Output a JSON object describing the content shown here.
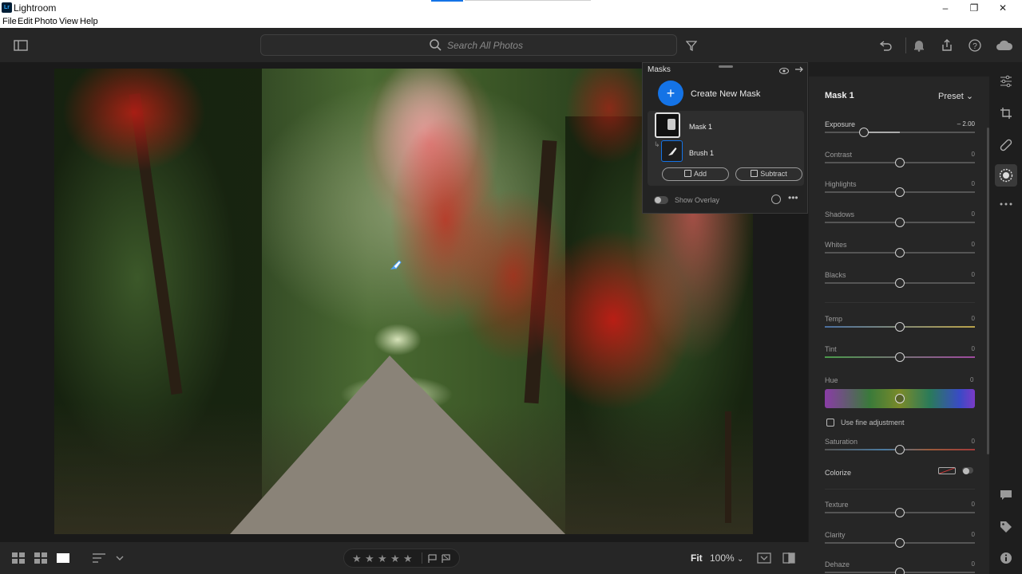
{
  "window": {
    "title": "Lightroom",
    "logo_text": "Lr"
  },
  "menu": [
    "File",
    "Edit",
    "Photo",
    "View",
    "Help"
  ],
  "window_controls": {
    "minimize": "–",
    "maximize": "❐",
    "close": "✕"
  },
  "search": {
    "placeholder": "Search All Photos"
  },
  "masks_panel": {
    "header": "Masks",
    "create_label": "Create New Mask",
    "masks": [
      {
        "name": "Mask 1",
        "components": [
          {
            "name": "Brush 1"
          }
        ]
      }
    ],
    "add_label": "Add",
    "subtract_label": "Subtract",
    "show_overlay_label": "Show Overlay"
  },
  "edit_panel": {
    "mask_name": "Mask 1",
    "preset_label": "Preset",
    "sliders": [
      {
        "label": "Exposure",
        "value": "– 2.00",
        "position": 0.26
      },
      {
        "label": "Contrast",
        "value": "0",
        "position": 0.5
      },
      {
        "label": "Highlights",
        "value": "0",
        "position": 0.5
      },
      {
        "label": "Shadows",
        "value": "0",
        "position": 0.5
      },
      {
        "label": "Whites",
        "value": "0",
        "position": 0.5
      },
      {
        "label": "Blacks",
        "value": "0",
        "position": 0.5
      },
      {
        "label": "Temp",
        "value": "0",
        "position": 0.5
      },
      {
        "label": "Tint",
        "value": "0",
        "position": 0.5
      }
    ],
    "hue": {
      "label": "Hue",
      "value": "0"
    },
    "fine_adjust_label": "Use fine adjustment",
    "saturation": {
      "label": "Saturation",
      "value": "0",
      "position": 0.5
    },
    "colorize_label": "Colorize",
    "sliders_bottom": [
      {
        "label": "Texture",
        "value": "0",
        "position": 0.5
      },
      {
        "label": "Clarity",
        "value": "0",
        "position": 0.5
      },
      {
        "label": "Dehaze",
        "value": "0",
        "position": 0.5
      }
    ]
  },
  "bottom_bar": {
    "fit_label": "Fit",
    "zoom_label": "100%",
    "stars": [
      "★",
      "★",
      "★",
      "★",
      "★"
    ]
  },
  "colors": {
    "accent": "#1473e6",
    "mask_overlay": "#d21e14"
  }
}
